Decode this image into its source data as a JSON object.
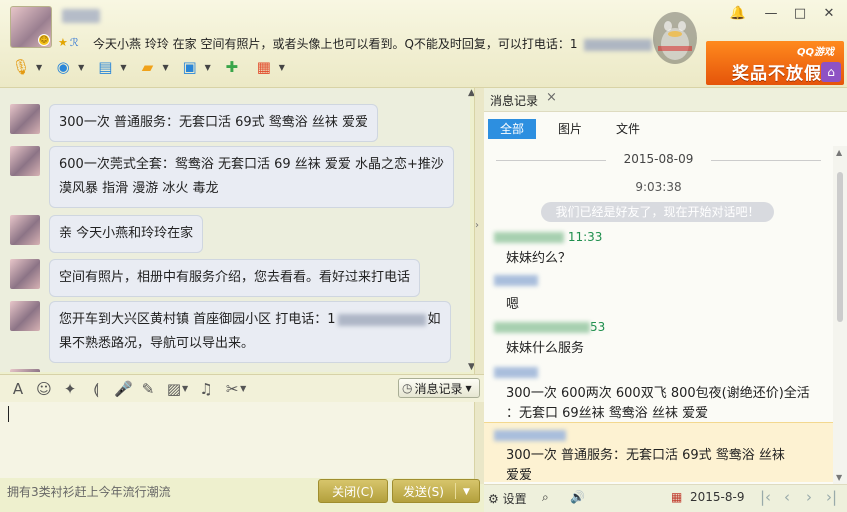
{
  "header": {
    "signature": "今天小燕 玲玲  在家 空间有照片，或者头像上也可以看到。Q不能及时回复，可以打电话：1",
    "window_controls": [
      "🔔",
      "—",
      "□",
      "✕"
    ]
  },
  "ad": {
    "brand": "QQ游戏",
    "slogan": "奖品不放假"
  },
  "toolbar": {
    "items": [
      "voice-call",
      "video-call",
      "screen-share",
      "file-transfer",
      "remote-assist",
      "create-group",
      "apps"
    ]
  },
  "chat": {
    "messages": [
      {
        "text": "300一次  普通服务：无套口活  69式  鸳鸯浴  丝袜  爱爱"
      },
      {
        "line1": "600一次莞式全套：鸳鸯浴 无套口活 69 丝袜 爱爱 水晶之恋+推沙",
        "line2": "漠风暴 指滑 漫游 冰火 毒龙"
      },
      {
        "text": "亲  今天小燕和玲玲在家"
      },
      {
        "text": "空间有照片，相册中有服务介绍，您去看看。看好过来打电话"
      },
      {
        "line1a": "您开车到大兴区黄村镇 首座御园小区 打电话：1",
        "line1b": "如",
        "line2": "果不熟悉路况，导航可以导出来。"
      }
    ]
  },
  "composer": {
    "history_label": "消息记录",
    "tip": "拥有3类衬衫赶上今年流行潮流",
    "close_label": "关闭(C)",
    "send_label": "发送(S)"
  },
  "history": {
    "tab_label": "消息记录",
    "filters": [
      "全部",
      "图片",
      "文件"
    ],
    "date": "2015-08-09",
    "time": "9:03:38",
    "system_msg": "我们已经是好友了，现在开始对话吧！",
    "entries": [
      {
        "time": "11:33",
        "text": "妹妹约么？"
      },
      {
        "time": "",
        "text": "嗯"
      },
      {
        "time": "53",
        "text": "妹妹什么服务"
      },
      {
        "time": "",
        "line1": "300一次 600两次 600双飞 800包夜(谢绝还价)全活",
        "line2": "：无套口 69丝袜 鸳鸯浴 丝袜  爱爱"
      },
      {
        "time": "",
        "line1": "300一次  普通服务：无套口活  69式  鸳鸯浴  丝袜",
        "line2": "爱爱"
      }
    ],
    "footer": {
      "settings_label": "设置",
      "date": "2015-8-9"
    }
  }
}
